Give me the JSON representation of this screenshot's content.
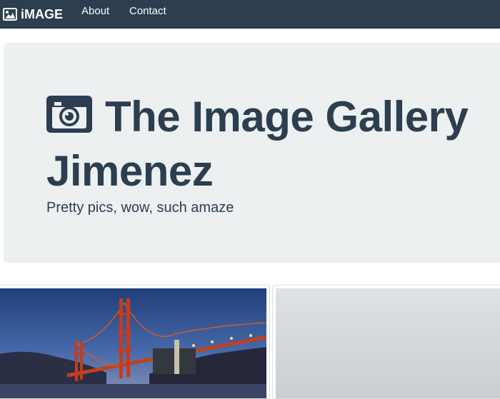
{
  "navbar": {
    "brand_label": "iMAGE",
    "brand_icon": "picture-icon",
    "links": [
      {
        "label": "About"
      },
      {
        "label": "Contact"
      }
    ]
  },
  "jumbotron": {
    "title_icon": "camera-icon",
    "title_line1": "The Image Gallery",
    "title_line2": "Jimenez",
    "subtitle": "Pretty pics, wow, such amaze"
  },
  "gallery": {
    "images": [
      {
        "subject": "golden-gate-bridge-night"
      },
      {
        "subject": "foggy-sky"
      }
    ]
  },
  "colors": {
    "navbar": "#2c3e50",
    "jumbotron_bg": "#ecf0f1",
    "title_text": "#2c3e50"
  }
}
